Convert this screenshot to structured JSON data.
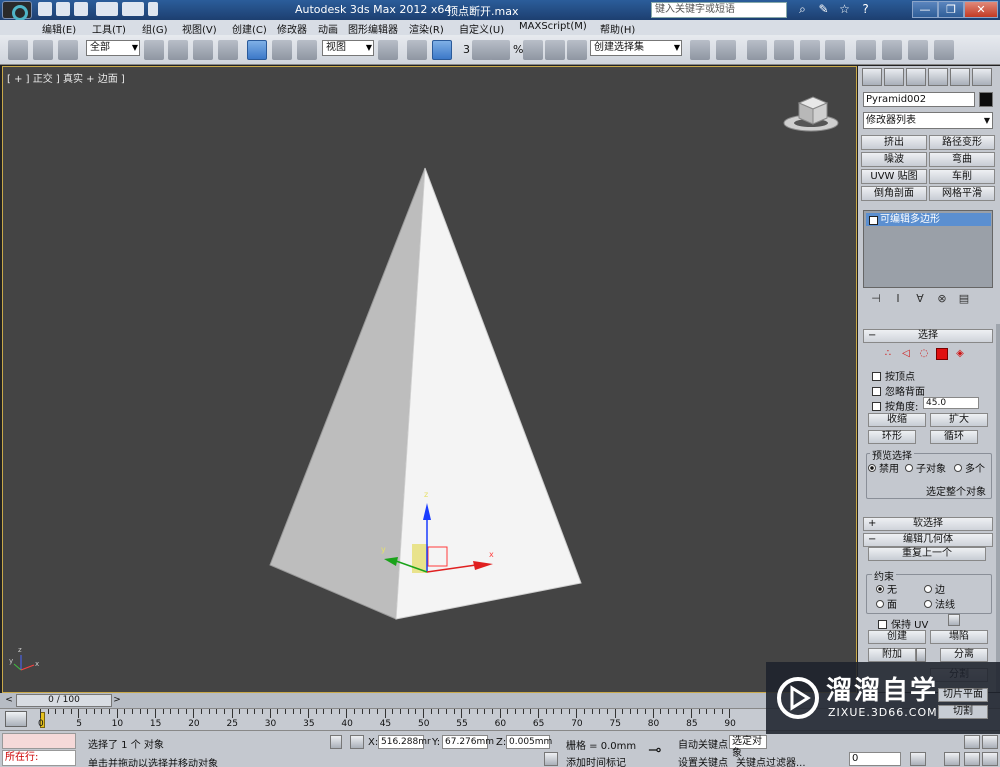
{
  "title_bar": {
    "app_title": "Autodesk 3ds Max  2012 x64",
    "file_name": "顶点断开.max",
    "search_placeholder": "键入关键字或短语"
  },
  "menu": {
    "items": [
      "编辑(E)",
      "工具(T)",
      "组(G)",
      "视图(V)",
      "创建(C)",
      "修改器",
      "动画",
      "图形编辑器",
      "渲染(R)",
      "自定义(U)",
      "MAXScript(M)",
      "帮助(H)"
    ]
  },
  "toolbar": {
    "filter_value": "全部",
    "ref_coord_value": "视图",
    "snap_labels": [
      "3",
      "%"
    ],
    "named_selection_value": "创建选择集"
  },
  "viewport": {
    "label": "[ + ] 正交 ] 真实 + 边面 ]",
    "gizmo_labels": {
      "x": "x",
      "y": "y",
      "z": "z"
    }
  },
  "command_panel": {
    "object_name": "Pyramid002",
    "modifier_list": "修改器列表",
    "modifier_buttons": [
      "挤出",
      "路径变形",
      "噪波",
      "弯曲",
      "UVW 贴图",
      "车削",
      "倒角剖面",
      "网格平滑"
    ],
    "stack_item": "可编辑多边形",
    "selection_header": "选择",
    "by_vertex": "按顶点",
    "ignore_backfacing": "忽略背面",
    "by_angle": "按角度:",
    "angle_value": "45.0",
    "shrink": "收缩",
    "grow": "扩大",
    "ring": "环形",
    "loop": "循环",
    "preview_selection": "预览选择",
    "preview_options": [
      "禁用",
      "子对象",
      "多个"
    ],
    "select_whole": "选定整个对象",
    "soft_selection": "软选择",
    "edit_geometry": "编辑几何体",
    "repeat_last": "重复上一个",
    "constraints": "约束",
    "constraint_options": [
      "无",
      "边",
      "面",
      "法线"
    ],
    "preserve_uv": "保持 UV",
    "create": "创建",
    "collapse": "塌陷",
    "attach": "附加",
    "detach": "分离",
    "slice_partial": "分割",
    "slice_plane_partial": "切片平面",
    "cut_partial": "切割"
  },
  "time": {
    "frame_counter": "0 / 100",
    "ruler_labels": [
      "0",
      "5",
      "10",
      "15",
      "20",
      "25",
      "30",
      "35",
      "40",
      "45",
      "50",
      "55",
      "60",
      "65",
      "70",
      "75",
      "80",
      "85",
      "90"
    ]
  },
  "status": {
    "maxscript_prompt": "所在行:",
    "selected_text": "选择了 1 个 对象",
    "hint_text": "单击并拖动以选择并移动对象",
    "x_value": "516.288mr",
    "y_value": "67.276mm",
    "z_value": "0.005mm",
    "grid_text": "栅格 = 0.0mm",
    "add_time_tag": "添加时间标记",
    "auto_key": "自动关键点",
    "selected_dropdown": "选定对象",
    "set_key": "设置关键点",
    "key_filters": "关键点过滤器...",
    "frame_value": "0"
  },
  "watermark": {
    "brand": "溜溜自学",
    "url": "ZIXUE.3D66.COM"
  },
  "colors": {
    "viewport_bg": "#444444",
    "selection_blue": "#5b8fd0",
    "accent_red": "#e01010"
  }
}
